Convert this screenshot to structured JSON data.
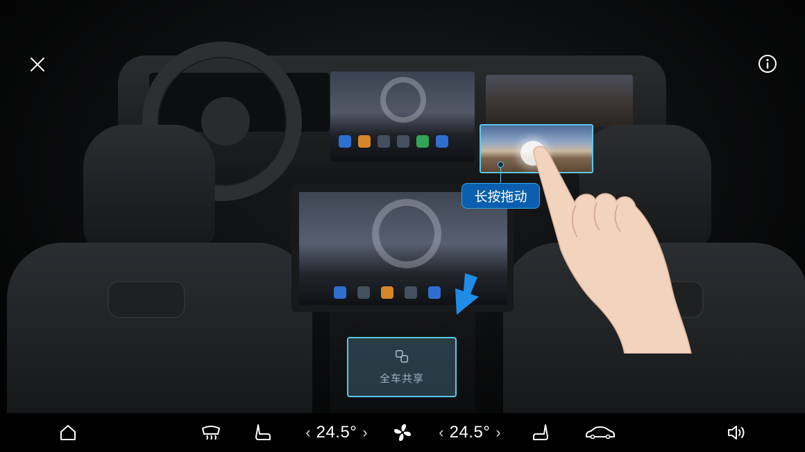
{
  "overlay": {
    "tooltip_text": "长按拖动",
    "share_zone_label": "全车共享",
    "close_icon": "close-icon",
    "info_icon": "info-icon",
    "share_icon": "share-screens-icon",
    "accent_color": "#59c8ee",
    "tooltip_color": "#0b5fae",
    "arrow_color": "#1f8de8"
  },
  "bottom_bar": {
    "home_icon": "home-icon",
    "rear_defrost_icon": "rear-defrost-icon",
    "driver_seat_icon": "seat-heat-icon",
    "left_temp": {
      "value": "24.5°",
      "decrease": "‹",
      "increase": "›"
    },
    "fan_icon": "fan-icon",
    "right_temp": {
      "value": "24.5°",
      "decrease": "‹",
      "increase": "›"
    },
    "passenger_seat_icon": "seat-heat-icon",
    "car_icon": "car-icon",
    "volume_icon": "volume-icon"
  }
}
